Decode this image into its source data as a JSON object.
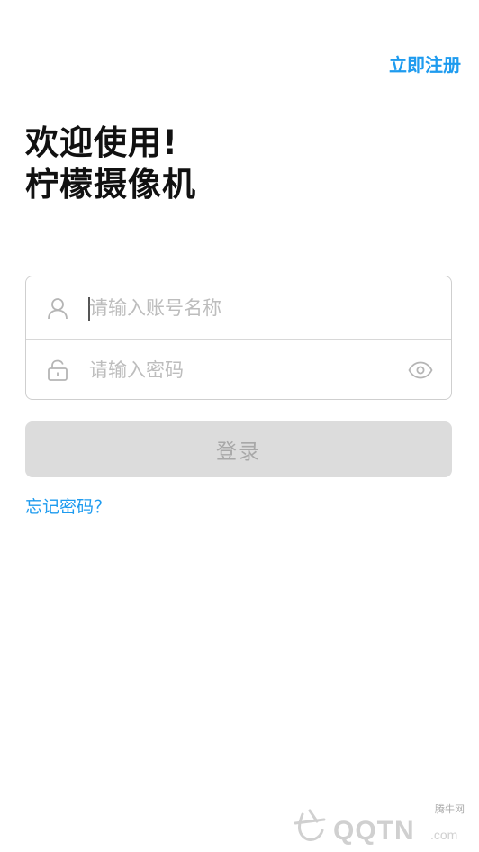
{
  "header": {
    "register_label": "立即注册"
  },
  "welcome": {
    "line1": "欢迎使用!",
    "line2": "柠檬摄像机"
  },
  "form": {
    "account": {
      "placeholder": "请输入账号名称",
      "value": "",
      "icon": "user-icon"
    },
    "password": {
      "placeholder": "请输入密码",
      "value": "",
      "icon": "lock-icon",
      "toggle_icon": "eye-icon"
    }
  },
  "login": {
    "label": "登录",
    "disabled": true
  },
  "forgot": {
    "label": "忘记密码？"
  },
  "watermark": {
    "text": "腾牛网",
    "brand": "QQTN",
    "domain": ".com"
  },
  "colors": {
    "accent": "#1e9bef",
    "button_disabled_bg": "#dcdcdc",
    "button_disabled_text": "#a8a8a8",
    "placeholder": "#bdbdbd"
  }
}
